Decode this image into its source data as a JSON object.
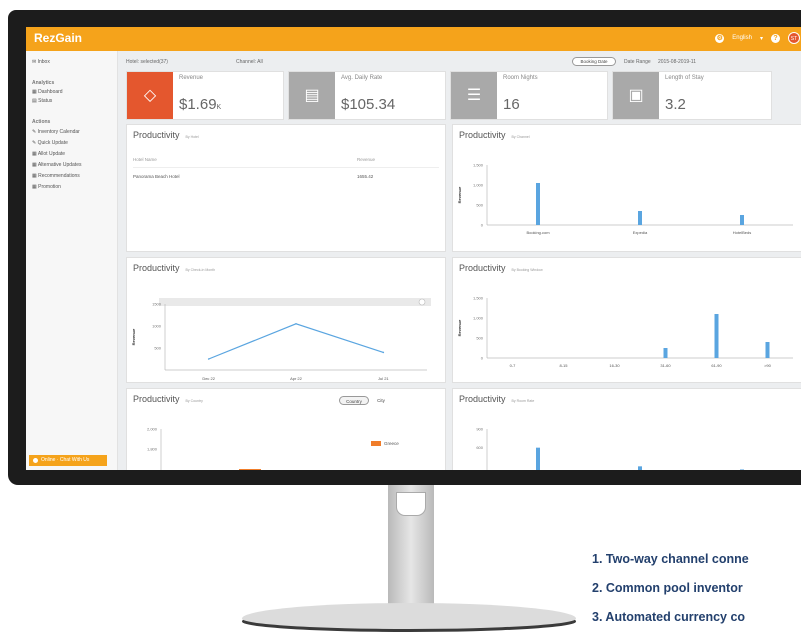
{
  "app": {
    "logo": "RezGain",
    "language": "English",
    "avatar_initials": "ST"
  },
  "sidebar": {
    "inbox": "Inbox",
    "section1": "Analytics",
    "dashboard": "Dashboard",
    "status": "Status",
    "section2": "Actions",
    "items": [
      "Inventory Calendar",
      "Quick Update",
      "Allot Update",
      "Alternative Updates",
      "Recommendations",
      "Promotion"
    ],
    "chat": "Online · Chat With Us"
  },
  "filters": {
    "hotel": "Hotel: selected(37)",
    "channel": "Channel: All",
    "booking_date": "Booking Date",
    "date_range_label": "Date Range",
    "date_range": "2015-08-2019-11"
  },
  "kpis": [
    {
      "label": "Revenue",
      "value": "$1.69",
      "suffix": "K",
      "color": "#e4572e"
    },
    {
      "label": "Avg. Daily Rate",
      "value": "$105.34",
      "color": "#a9a9a9"
    },
    {
      "label": "Room Nights",
      "value": "16",
      "color": "#a9a9a9"
    },
    {
      "label": "Length of Stay",
      "value": "3.2",
      "color": "#a9a9a9"
    }
  ],
  "panels": {
    "p1": {
      "title": "Productivity",
      "sub": "By Hotel",
      "col1": "Hotel Name",
      "col2": "Revenue",
      "row_name": "Panorama Beach Hotel",
      "row_value": "1655.42"
    },
    "p2": {
      "title": "Productivity",
      "sub": "By Channel"
    },
    "p3": {
      "title": "Productivity",
      "sub": "By Check-in Month"
    },
    "p4": {
      "title": "Productivity",
      "sub": "By Booking Window"
    },
    "p5": {
      "title": "Productivity",
      "sub": "By Country",
      "toggle1": "Country",
      "toggle2": "City",
      "legend": "Greece"
    },
    "p6": {
      "title": "Productivity",
      "sub": "By Room Rate"
    }
  },
  "bullets": [
    "1. Two-way channel conne",
    "2. Common pool inventor",
    "3. Automated currency co"
  ],
  "chart_data": [
    {
      "type": "bar",
      "title": "Productivity",
      "ylabel": "Revenue",
      "categories": [
        "Booking.com",
        "Expedia",
        "HotelBeds"
      ],
      "values": [
        1050,
        350,
        250
      ],
      "ylim": [
        0,
        1500
      ],
      "yticks": [
        "0",
        "500",
        "1,000",
        "1,500"
      ],
      "color": "#5aa5e0"
    },
    {
      "type": "line",
      "title": "Productivity",
      "ylabel": "Revenue",
      "categories": [
        "Dec 22",
        "Apr 22",
        "Jul 21"
      ],
      "values": [
        250,
        1050,
        400
      ],
      "ylim": [
        0,
        1500
      ],
      "yticks": [
        "500",
        "1000",
        "1500"
      ],
      "color": "#5aa5e0"
    },
    {
      "type": "bar",
      "title": "Productivity",
      "ylabel": "Revenue",
      "categories": [
        "0-7",
        "8-15",
        "16-30",
        "31-60",
        "61-90",
        ">90"
      ],
      "values": [
        0,
        0,
        0,
        250,
        1100,
        400
      ],
      "ylim": [
        0,
        1500
      ],
      "yticks": [
        "0",
        "500",
        "1,000",
        "1,500"
      ],
      "color": "#5aa5e0"
    },
    {
      "type": "bar",
      "title": "Productivity",
      "series": [
        {
          "name": "Greece",
          "values": [
            1600
          ]
        }
      ],
      "ylim": [
        1400,
        2000
      ],
      "yticks": [
        "1,400",
        "1,800",
        "2,000"
      ],
      "color": "#f07d2a"
    },
    {
      "type": "bar",
      "title": "Productivity",
      "values": [
        600,
        300,
        250
      ],
      "ylim": [
        0,
        900
      ],
      "yticks": [
        "600",
        "900"
      ],
      "color": "#5aa5e0"
    }
  ]
}
